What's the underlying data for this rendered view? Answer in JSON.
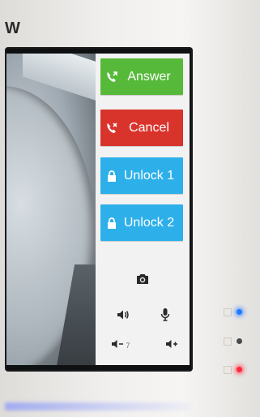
{
  "brand": {
    "text": "W"
  },
  "panel": {
    "answer": {
      "label": "Answer",
      "icon": "phone-answer-icon",
      "color": "#57b93a"
    },
    "cancel": {
      "label": "Cancel",
      "icon": "phone-hangup-icon",
      "color": "#d9342c"
    },
    "unlock1": {
      "label": "Unlock 1",
      "icon": "lock-icon",
      "color": "#2db0ea"
    },
    "unlock2": {
      "label": "Unlock 2",
      "icon": "lock-icon",
      "color": "#2db0ea"
    },
    "camera": {
      "icon": "camera-icon"
    },
    "speaker": {
      "icon": "speaker-icon"
    },
    "mic": {
      "icon": "microphone-icon"
    },
    "volume_down": {
      "icon": "volume-down-icon",
      "level": "7"
    },
    "volume_up": {
      "icon": "volume-up-icon"
    }
  },
  "leds": [
    {
      "name": "status-led-blue",
      "color": "#1e7cff"
    },
    {
      "name": "status-led-grey",
      "color": "#4a4a48"
    },
    {
      "name": "status-led-red",
      "color": "#ff2a3b"
    }
  ]
}
